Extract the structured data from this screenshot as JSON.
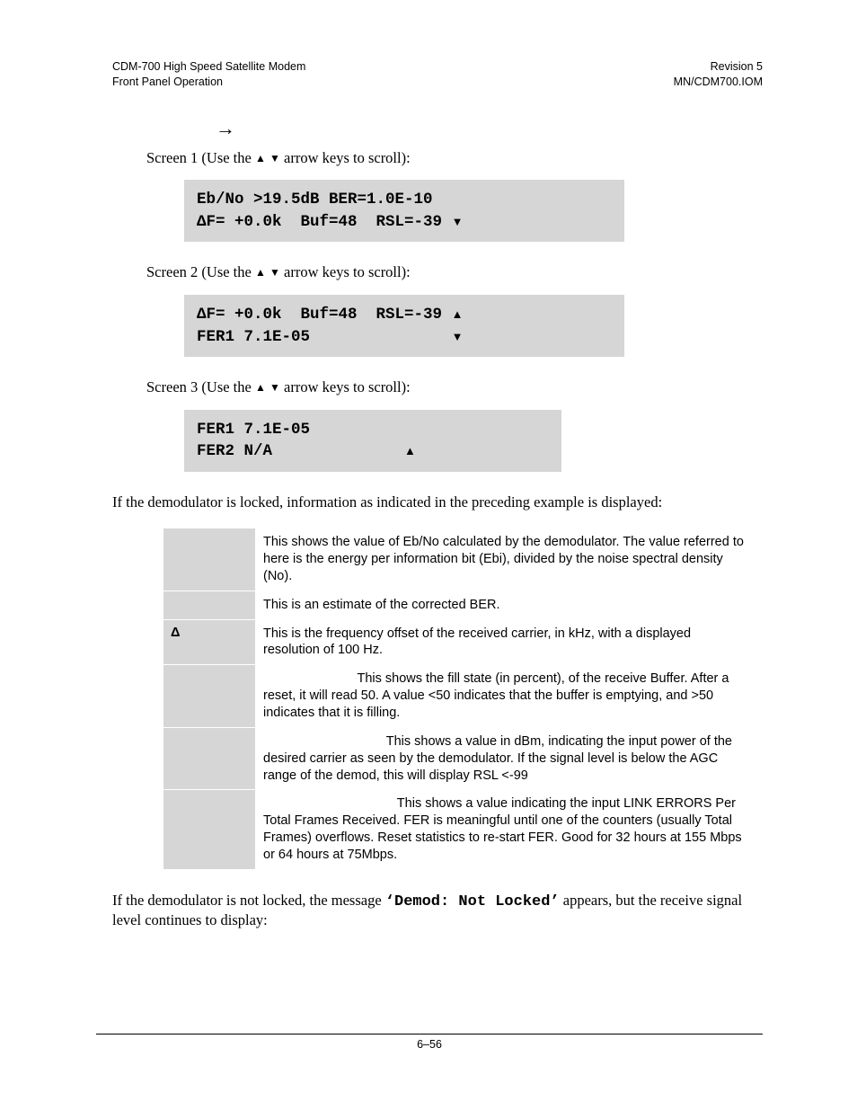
{
  "header": {
    "left1": "CDM-700 High Speed Satellite Modem",
    "left2": "Front Panel Operation",
    "right1": "Revision 5",
    "right2": "MN/CDM700.IOM"
  },
  "arrow_glyph": "→",
  "screen_intro_prefix": "Screen ",
  "screen_intro_mid": " (Use the ",
  "up_glyph": "▲",
  "down_glyph": "▼",
  "screen_intro_suffix": " arrow keys to scroll):",
  "screens": [
    {
      "n": "1",
      "line1": "Eb/No >19.5dB BER=1.0E-10",
      "line2_left": "ΔF= +0.0k  Buf=48  RSL=-39",
      "line2_arrow": "▼"
    },
    {
      "n": "2",
      "line1_left": "ΔF= +0.0k  Buf=48  RSL=-39",
      "line1_arrow": "▲",
      "line2_left": "FER1 7.1E-05",
      "line2_arrow": "▼"
    },
    {
      "n": "3",
      "line1": "FER1 7.1E-05",
      "line2_left": "FER2 N/A",
      "line2_arrow": "▲"
    }
  ],
  "locked_para": "If the demodulator is locked, information as indicated in the preceding example is displayed:",
  "table": [
    {
      "label": "",
      "desc": "This shows the value of Eb/No calculated by the demodulator. The value referred to here is the energy per information bit (Ebi), divided by the noise spectral density (No)."
    },
    {
      "label": "",
      "desc": "This is an estimate of the corrected BER."
    },
    {
      "label": "Δ",
      "desc": "This is the frequency offset of the received carrier, in kHz, with a displayed resolution of 100 Hz."
    },
    {
      "label": "",
      "lead": "",
      "desc": "This shows the fill state (in percent), of the receive Buffer. After a reset, it will read 50. A value <50 indicates that the buffer is emptying, and >50 indicates that it is filling.",
      "indent": "                          "
    },
    {
      "label": "",
      "lead": "",
      "desc": "This shows a value in dBm, indicating the input power of the desired carrier as seen by the demodulator. If the signal level is below the AGC range of the demod, this will display RSL <-99",
      "indent": "                                  "
    },
    {
      "label": "",
      "lead": "",
      "desc": "This shows a value indicating the input LINK ERRORS Per Total Frames Received.  FER is meaningful until one of the counters (usually Total Frames) overflows. Reset statistics to re-start FER. Good for 32 hours at 155 Mbps or 64 hours at 75Mbps.",
      "indent": "                                     "
    }
  ],
  "notlocked": {
    "pre": "If the demodulator is not locked, the message ",
    "code": "‘Demod: Not Locked’",
    "post": " appears, but the receive signal level continues to display:"
  },
  "page_number": "6–56"
}
